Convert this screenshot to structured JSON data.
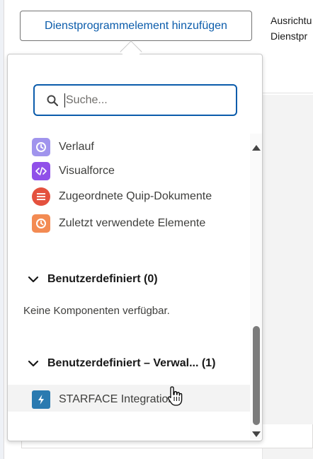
{
  "toolbar": {
    "add_button_label": "Dienstprogrammelement hinzufügen",
    "right_text_line1": "Ausrichtu",
    "right_text_line2": "Dienstpr"
  },
  "search": {
    "placeholder": "Suche...",
    "value": ""
  },
  "items": [
    {
      "label": "Verlauf",
      "icon": "clock-icon",
      "color": "#a094ed"
    },
    {
      "label": "Visualforce",
      "icon": "code-icon",
      "color": "#9050e9"
    },
    {
      "label": "Zugeordnete Quip-Dokumente",
      "icon": "quip-icon",
      "color": "#e4513e"
    },
    {
      "label": "Zuletzt verwendete Elemente",
      "icon": "clock-icon",
      "color": "#f38b53"
    }
  ],
  "sections": [
    {
      "label": "Benutzerdefiniert (0)",
      "empty_text": "Keine Komponenten verfügbar."
    },
    {
      "label": "Benutzerdefiniert – Verwal...  (1)"
    }
  ],
  "managed_items": [
    {
      "label": "STARFACE Integration",
      "icon": "lightning-icon",
      "color": "#2a7ab0"
    }
  ]
}
